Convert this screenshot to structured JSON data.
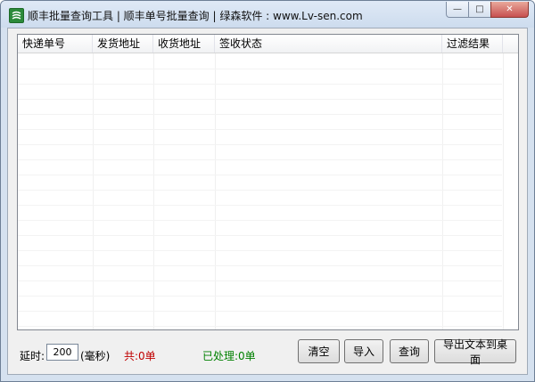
{
  "window": {
    "title": "顺丰批量查询工具 | 顺丰单号批量查询 | 绿森软件 : www.Lv-sen.com",
    "icon": "app-logo-icon",
    "caption_min": "—",
    "caption_max": "□",
    "caption_close": "✕"
  },
  "table": {
    "columns": [
      "快递单号",
      "发货地址",
      "收货地址",
      "签收状态",
      "过滤结果"
    ],
    "rows": []
  },
  "controls": {
    "delay_label": "延时:",
    "delay_value": "200",
    "delay_unit": "(毫秒)",
    "total_label": "共:0单",
    "processed_label": "已处理:0单",
    "clear_button": "清空",
    "import_button": "导入",
    "query_button": "查询",
    "export_button": "导出文本到桌面"
  },
  "colors": {
    "total": "#c00000",
    "processed": "#008000"
  }
}
